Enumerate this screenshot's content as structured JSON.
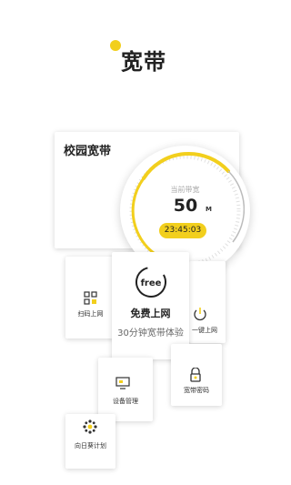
{
  "app": {
    "brand_title": "宽带",
    "accent_color": "#f2cf1d"
  },
  "main_card": {
    "title": "校园宽带",
    "bandwidth_label": "当前带宽",
    "bandwidth_value": "50",
    "bandwidth_unit": "M",
    "timer": "23:45:03"
  },
  "features": {
    "online": {
      "label": "扫码上网",
      "icon": "qr-grid-icon"
    },
    "free": {
      "icon_text": "free",
      "title": "免费上网",
      "subtitle": "30分钟宽带体验"
    },
    "onekey": {
      "label": "一键上网",
      "sub": "",
      "icon": "power-icon"
    },
    "device": {
      "label": "设备管理",
      "sub": "",
      "icon": "monitor-icon"
    },
    "password": {
      "label": "宽带密码",
      "sub": "",
      "icon": "lock-icon"
    },
    "plan": {
      "label": "向日葵计划",
      "icon": "sunflower-icon"
    }
  }
}
